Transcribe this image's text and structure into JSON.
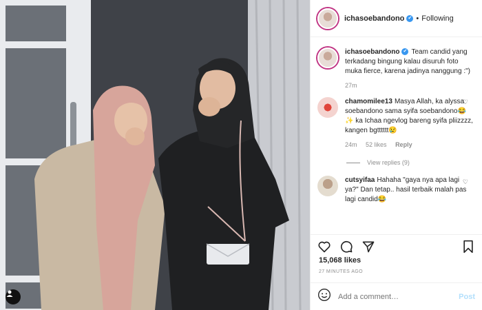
{
  "header": {
    "username": "ichasoebandono",
    "verified_mark": "✔",
    "separator": "•",
    "follow_status": "Following"
  },
  "caption": {
    "username": "ichasoebandono",
    "text": "Team candid yang terkadang bingung kalau disuruh foto muka fierce, karena jadinya nanggung :\")",
    "time": "27m"
  },
  "comments": [
    {
      "username": "chamomilee13",
      "text": "Masya Allah, ka alyssa soebandono sama syifa soebandono😂✨ ka Ichaa ngevlog bareng syifa pliizzzz, kangen bgtttttt😢",
      "time": "24m",
      "likes": "52 likes",
      "reply": "Reply",
      "view_replies": "View replies (9)"
    },
    {
      "username": "cutsyifaa",
      "text": "Hahaha \"gaya nya apa lagi ya?\" Dan tetap.. hasil terbaik malah pas lagi candid😂"
    }
  ],
  "stats": {
    "likes": "15,068 likes",
    "time_ago": "27 MINUTES AGO"
  },
  "add_comment": {
    "placeholder": "Add a comment…",
    "post_label": "Post"
  },
  "icons": [
    "user-tag-icon",
    "heart-icon",
    "comment-icon",
    "share-icon",
    "bookmark-icon",
    "emoji-icon",
    "verified-icon"
  ],
  "colors": {
    "verified": "#3897f0",
    "post_disabled": "#b2dffc",
    "muted": "#8e8e8e"
  }
}
